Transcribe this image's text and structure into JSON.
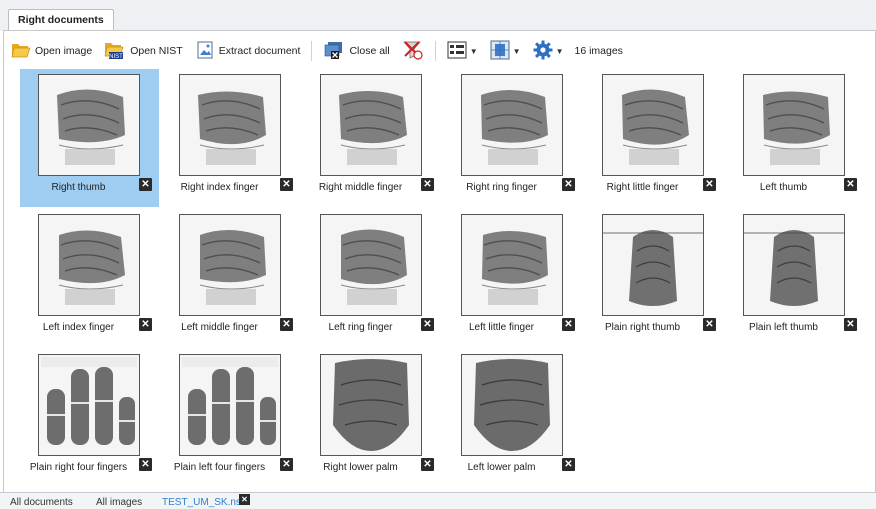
{
  "window": {
    "tab_title": "Right documents"
  },
  "toolbar": {
    "open_image": "Open image",
    "open_nist": "Open NIST",
    "extract_document": "Extract document",
    "close_all": "Close all",
    "image_count": "16 images"
  },
  "images": [
    {
      "label": "Right thumb",
      "close": "✕",
      "kind": "roll"
    },
    {
      "label": "Right index finger",
      "close": "✕",
      "kind": "roll"
    },
    {
      "label": "Right middle finger",
      "close": "✕",
      "kind": "roll"
    },
    {
      "label": "Right ring finger",
      "close": "✕",
      "kind": "roll"
    },
    {
      "label": "Right little finger",
      "close": "✕",
      "kind": "roll"
    },
    {
      "label": "Left thumb",
      "close": "✕",
      "kind": "roll"
    },
    {
      "label": "Left index finger",
      "close": "✕",
      "kind": "roll"
    },
    {
      "label": "Left middle finger",
      "close": "✕",
      "kind": "roll"
    },
    {
      "label": "Left ring finger",
      "close": "✕",
      "kind": "roll"
    },
    {
      "label": "Left little finger",
      "close": "✕",
      "kind": "roll"
    },
    {
      "label": "Plain right thumb",
      "close": "✕",
      "kind": "plain"
    },
    {
      "label": "Plain left thumb",
      "close": "✕",
      "kind": "plain"
    },
    {
      "label": "Plain right four fingers",
      "close": "✕",
      "kind": "four"
    },
    {
      "label": "Plain left four fingers",
      "close": "✕",
      "kind": "four"
    },
    {
      "label": "Right lower palm",
      "close": "✕",
      "kind": "palm"
    },
    {
      "label": "Left lower palm",
      "close": "✕",
      "kind": "palm"
    }
  ],
  "selected_index": 0,
  "bottom_tabs": {
    "all_documents": "All documents",
    "all_images": "All images",
    "active_file": "TEST_UM_SK.nst",
    "close": "✕"
  },
  "colors": {
    "selection": "#9fcdf2",
    "active_tab": "#2a7fd4"
  }
}
